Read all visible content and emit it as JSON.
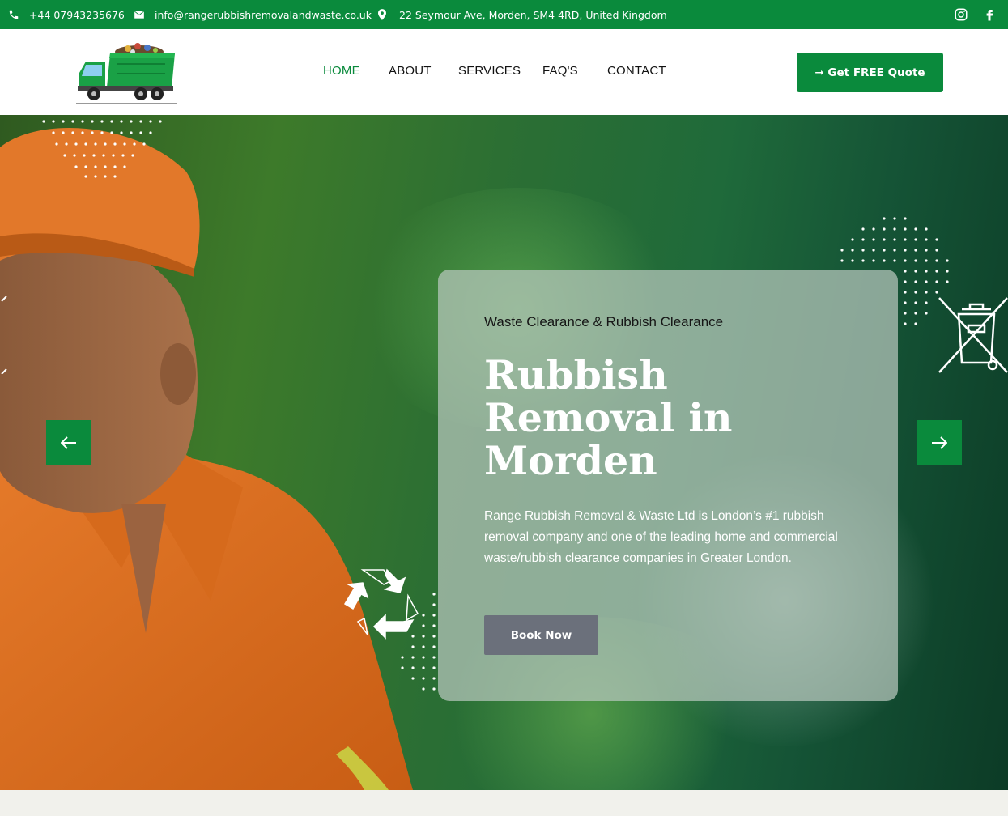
{
  "topbar": {
    "phone": "+44 07943235676",
    "email": "info@rangerubbishremovalandwaste.co.uk",
    "address": "22 Seymour Ave, Morden, SM4 4RD, United Kingdom",
    "icons": [
      "phone-icon",
      "envelope-icon",
      "map-pin-icon",
      "instagram-icon",
      "facebook-icon"
    ]
  },
  "header": {
    "nav": [
      "HOME",
      "ABOUT",
      "SERVICES",
      "FAQ'S",
      "CONTACT"
    ],
    "active_nav": "HOME",
    "quote_button": "➞ Get FREE Quote"
  },
  "hero": {
    "eyebrow": "Waste Clearance & Rubbish Clearance",
    "title": "Rubbish Removal in Morden",
    "description": "Range Rubbish Removal & Waste Ltd is London’s #1 rubbish removal company and one of the leading home and commercial waste/rubbish clearance companies in Greater London.",
    "cta": "Book Now",
    "prev_icon": "arrow-left-icon",
    "next_icon": "arrow-right-icon"
  },
  "colors": {
    "brand_green": "#0a8a3c",
    "cta_gray": "#6b707b",
    "card_overlay": "rgba(185,200,190,0.72)"
  }
}
